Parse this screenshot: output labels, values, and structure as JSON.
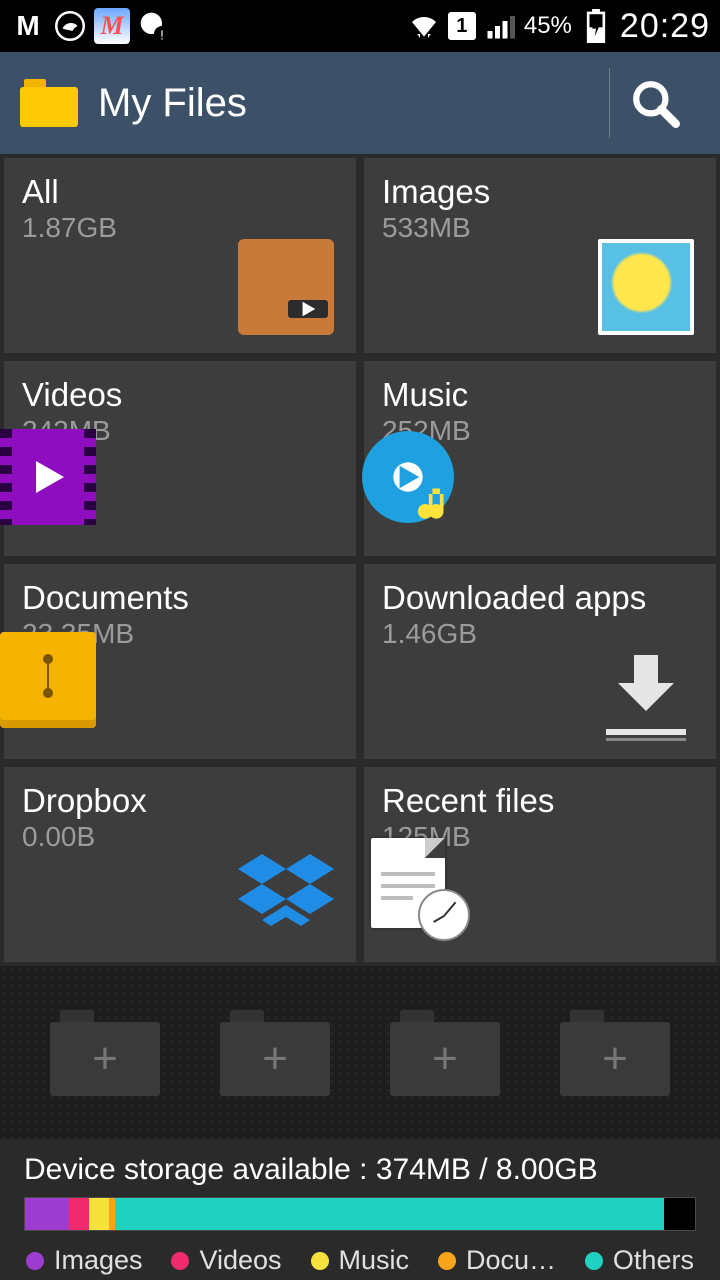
{
  "status": {
    "battery_pct": "45%",
    "time": "20:29",
    "sim": "1"
  },
  "appbar": {
    "title": "My Files"
  },
  "tiles": [
    {
      "title": "All",
      "sub": "1.87GB",
      "icon": "all"
    },
    {
      "title": "Images",
      "sub": "533MB",
      "icon": "images"
    },
    {
      "title": "Videos",
      "sub": "242MB",
      "icon": "videos"
    },
    {
      "title": "Music",
      "sub": "252MB",
      "icon": "music"
    },
    {
      "title": "Documents",
      "sub": "23.35MB",
      "icon": "docs"
    },
    {
      "title": "Downloaded apps",
      "sub": "1.46GB",
      "icon": "download"
    },
    {
      "title": "Dropbox",
      "sub": "0.00B",
      "icon": "dropbox"
    },
    {
      "title": "Recent files",
      "sub": "125MB",
      "icon": "recent"
    }
  ],
  "storage": {
    "label": "Device storage available : 374MB / 8.00GB",
    "segments": [
      {
        "name": "Images",
        "color": "#9c3dcf",
        "pct": 6.5
      },
      {
        "name": "Videos",
        "color": "#ef2b6e",
        "pct": 3.0
      },
      {
        "name": "Music",
        "color": "#f6e23a",
        "pct": 3.1
      },
      {
        "name": "Docu…",
        "color": "#f7a41a",
        "pct": 0.8
      },
      {
        "name": "Others",
        "color": "#1fd1c0",
        "pct": 82.0
      }
    ],
    "remaining_color": "#000",
    "remaining_pct": 4.6
  }
}
